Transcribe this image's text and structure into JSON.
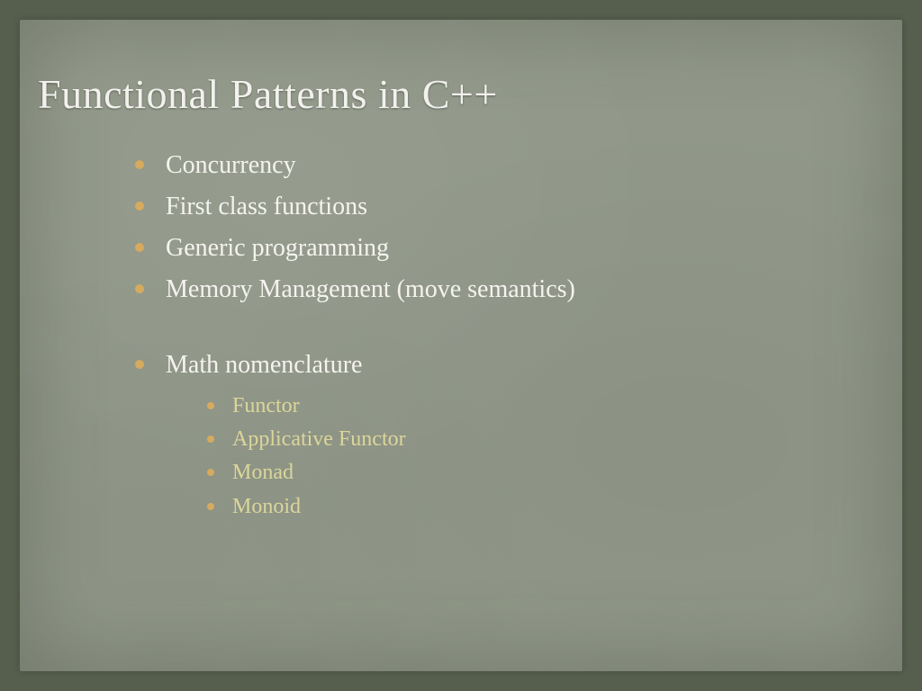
{
  "slide": {
    "title": "Functional Patterns in C++",
    "bullets": [
      "Concurrency",
      "First class functions",
      "Generic programming",
      "Memory Management (move semantics)"
    ],
    "section_heading": "Math nomenclature",
    "sub_bullets": [
      "Functor",
      "Applicative Functor",
      "Monad",
      "Monoid"
    ]
  },
  "colors": {
    "background_outer": "#565e4e",
    "paper": "#919889",
    "title_text": "#f2f1ed",
    "bullet_text": "#f5f3ee",
    "sub_bullet_text": "#dcd69a",
    "bullet_marker": "#d6aa5f"
  }
}
